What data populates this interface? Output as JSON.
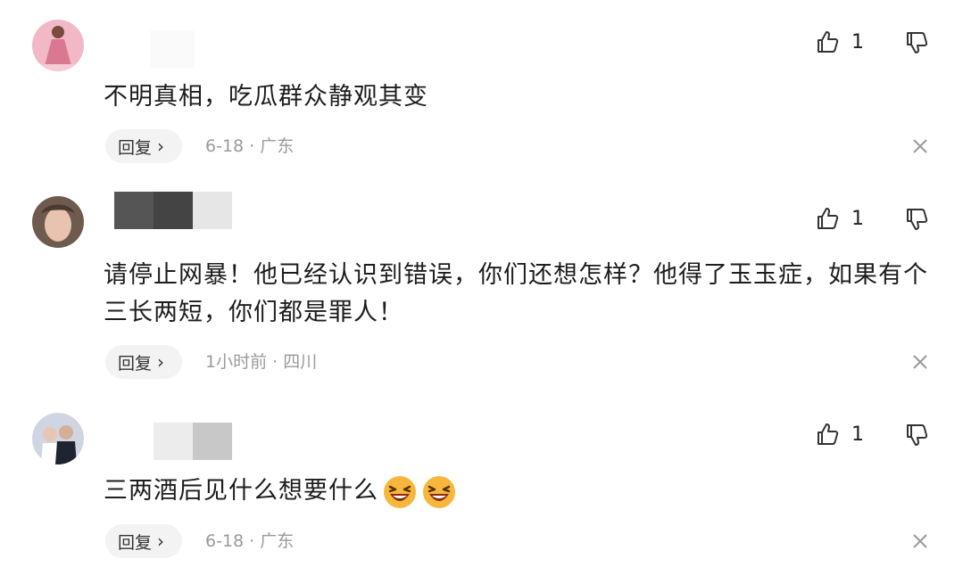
{
  "comments": [
    {
      "like_count": "1",
      "text": "不明真相，吃瓜群众静观其变",
      "reply_label": "回复",
      "reply_chevron": "›",
      "meta": "6-18 · 广东",
      "icons": {
        "like": "thumbs-up-icon",
        "dislike": "thumbs-down-icon",
        "close": "close-icon"
      }
    },
    {
      "like_count": "1",
      "text": "请停止网暴！他已经认识到错误，你们还想怎样？他得了玉玉症，如果有个三长两短，你们都是罪人！",
      "reply_label": "回复",
      "reply_chevron": "›",
      "meta": "1小时前 · 四川",
      "icons": {
        "like": "thumbs-up-icon",
        "dislike": "thumbs-down-icon",
        "close": "close-icon"
      }
    },
    {
      "like_count": "1",
      "text": "三两酒后见什么想要什么",
      "reply_label": "回复",
      "reply_chevron": "›",
      "meta": "6-18 · 广东",
      "emoji": [
        "laughing-face-emoji",
        "laughing-face-emoji"
      ],
      "icons": {
        "like": "thumbs-up-icon",
        "dislike": "thumbs-down-icon",
        "close": "close-icon"
      }
    }
  ],
  "colors": {
    "text": "#1d1d1d",
    "meta": "#9a9a9a",
    "reply_bg": "#f3f3f3",
    "icon": "#333333"
  }
}
